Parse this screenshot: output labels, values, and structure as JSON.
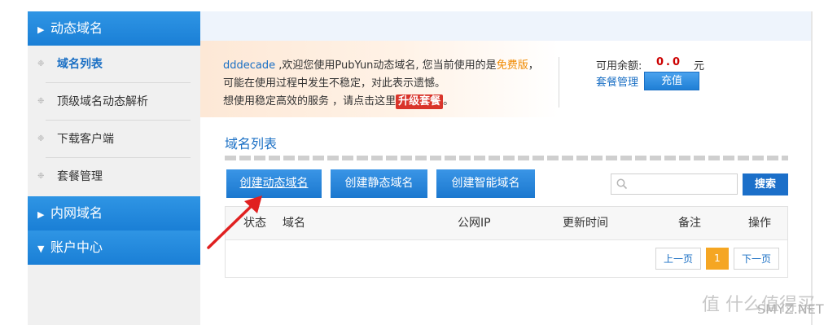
{
  "sidebar": {
    "sections": [
      {
        "label": "动态域名",
        "arrow": "▶"
      },
      {
        "label": "内网域名",
        "arrow": "▶"
      },
      {
        "label": "账户中心",
        "arrow": "▼"
      }
    ],
    "items": [
      {
        "label": "域名列表",
        "active": true
      },
      {
        "label": "顶级域名动态解析"
      },
      {
        "label": "下载客户端"
      },
      {
        "label": "套餐管理"
      }
    ],
    "bullet": "❉"
  },
  "notice": {
    "username": "dddecade",
    "welcome": " ,欢迎您使用PubYun动态域名, 您当前使用的是",
    "plan": "免费版",
    "warn": "，可能在使用过程中发生不稳定，对此表示遗憾。",
    "line3_prefix": "想使用稳定高效的服务 ，请点击这里",
    "upgrade": "升级套餐",
    "line3_suffix": "。"
  },
  "account": {
    "balance_label": "可用余额:",
    "balance_value": "0.0",
    "balance_unit": "元",
    "plan_manage": "套餐管理",
    "recharge": "充值"
  },
  "main": {
    "list_title": "域名列表",
    "buttons": {
      "dynamic": "创建动态域名",
      "static": "创建静态域名",
      "smart": "创建智能域名"
    },
    "search": {
      "placeholder": "",
      "button": "搜索",
      "icon": "search-icon"
    },
    "table": {
      "headers": [
        "状态",
        "域名",
        "公网IP",
        "更新时间",
        "备注",
        "操作"
      ],
      "rows": []
    },
    "pagination": {
      "prev": "上一页",
      "current": "1",
      "next": "下一页"
    }
  },
  "colors": {
    "accent": "#1a7fd6",
    "link": "#1a6fc4",
    "warn_orange": "#f08a00",
    "upgrade_red": "#d9342a",
    "page_active": "#f5a623",
    "arrow_red": "#e02020"
  },
  "watermark": {
    "cn": "值 什么值得买",
    "en": "SMYZ.NET"
  }
}
